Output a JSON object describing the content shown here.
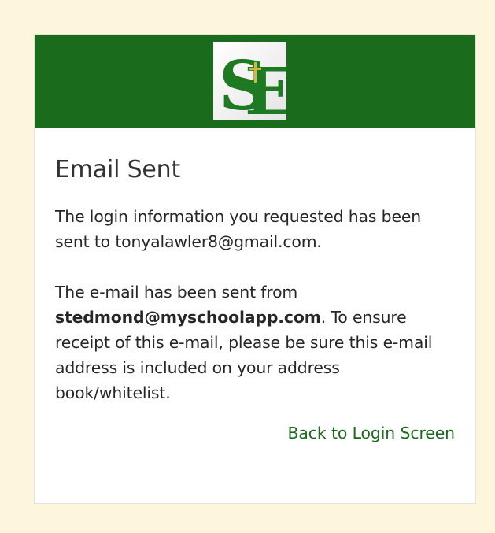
{
  "header": {
    "logo_text": "SE",
    "brand_color": "#1a6b1c"
  },
  "main": {
    "title": "Email Sent",
    "paragraph1": "The login information you requested has been sent to tonyalawler8@gmail.com.",
    "paragraph2_prefix": "The e-mail has been sent from ",
    "paragraph2_email": "stedmond@myschoolapp.com",
    "paragraph2_suffix": ". To ensure receipt of this e-mail, please be sure this e-mail address is included on your address book/whitelist.",
    "back_link": "Back to Login Screen"
  },
  "colors": {
    "page_background": "#fdf6dc",
    "card_background": "#ffffff",
    "link": "#1a6b1c"
  }
}
